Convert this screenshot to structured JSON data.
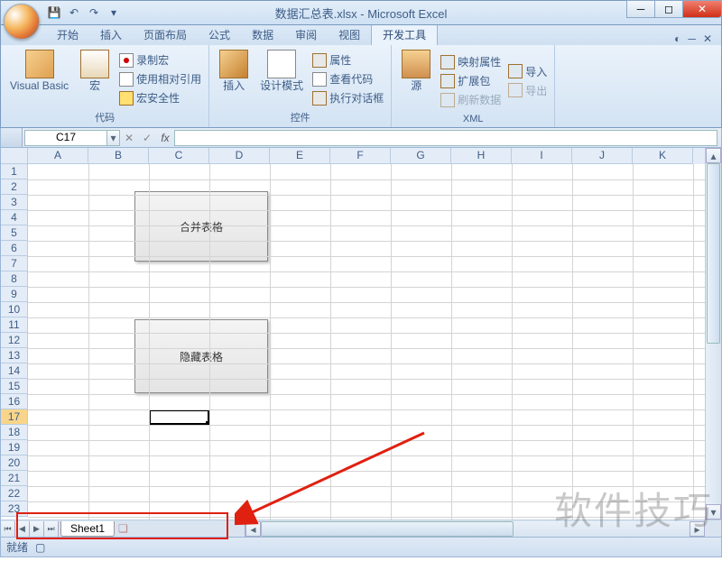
{
  "title": "数据汇总表.xlsx - Microsoft Excel",
  "tabs": [
    "开始",
    "插入",
    "页面布局",
    "公式",
    "数据",
    "审阅",
    "视图",
    "开发工具"
  ],
  "active_tab": 7,
  "ribbon": {
    "g1": {
      "label": "代码",
      "vb": "Visual Basic",
      "macro": "宏",
      "rec": "录制宏",
      "rel": "使用相对引用",
      "sec": "宏安全性"
    },
    "g2": {
      "label": "控件",
      "ins": "插入",
      "des": "设计模式",
      "prop": "属性",
      "code": "查看代码",
      "dlg": "执行对话框"
    },
    "g3": {
      "label": "XML",
      "src": "源",
      "map": "映射属性",
      "ext": "扩展包",
      "ref": "刷新数据",
      "imp": "导入",
      "exp": "导出"
    }
  },
  "namebox": "C17",
  "cols": [
    "A",
    "B",
    "C",
    "D",
    "E",
    "F",
    "G",
    "H",
    "I",
    "J",
    "K"
  ],
  "rows": [
    "1",
    "2",
    "3",
    "4",
    "5",
    "6",
    "7",
    "8",
    "9",
    "10",
    "11",
    "12",
    "13",
    "14",
    "15",
    "16",
    "17",
    "18",
    "19",
    "20",
    "21",
    "22",
    "23"
  ],
  "sel_row_idx": 16,
  "shapes": {
    "btn1": "合并表格",
    "btn2": "隐藏表格"
  },
  "sheet_tab": "Sheet1",
  "status": "就绪",
  "watermark": "软件技巧"
}
